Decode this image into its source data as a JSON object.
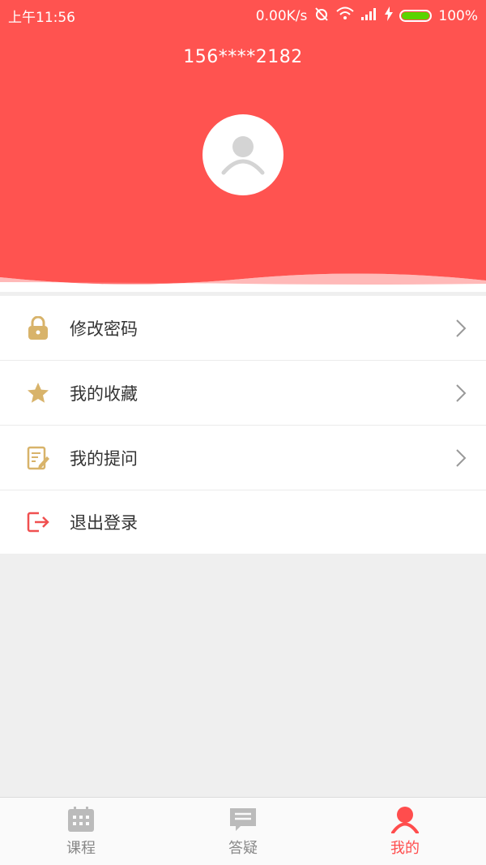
{
  "status_bar": {
    "time": "上午11:56",
    "network_speed": "0.00K/s",
    "battery": "100%",
    "battery_color": "#5ad400"
  },
  "profile": {
    "phone": "156****2182",
    "header_color": "#ff5350"
  },
  "menu": {
    "items": [
      {
        "label": "修改密码",
        "icon": "lock-icon",
        "icon_color": "#d8b36a",
        "has_arrow": true
      },
      {
        "label": "我的收藏",
        "icon": "star-icon",
        "icon_color": "#d8b36a",
        "has_arrow": true
      },
      {
        "label": "我的提问",
        "icon": "edit-note-icon",
        "icon_color": "#d8b36a",
        "has_arrow": true
      },
      {
        "label": "退出登录",
        "icon": "logout-icon",
        "icon_color": "#f05050",
        "has_arrow": false
      }
    ]
  },
  "tabbar": {
    "tabs": [
      {
        "label": "课程",
        "icon": "calendar-grid-icon",
        "active": false
      },
      {
        "label": "答疑",
        "icon": "message-list-icon",
        "active": false
      },
      {
        "label": "我的",
        "icon": "user-icon",
        "active": true
      }
    ],
    "active_color": "#ff4d4d",
    "inactive_color": "#bbbbbb"
  }
}
